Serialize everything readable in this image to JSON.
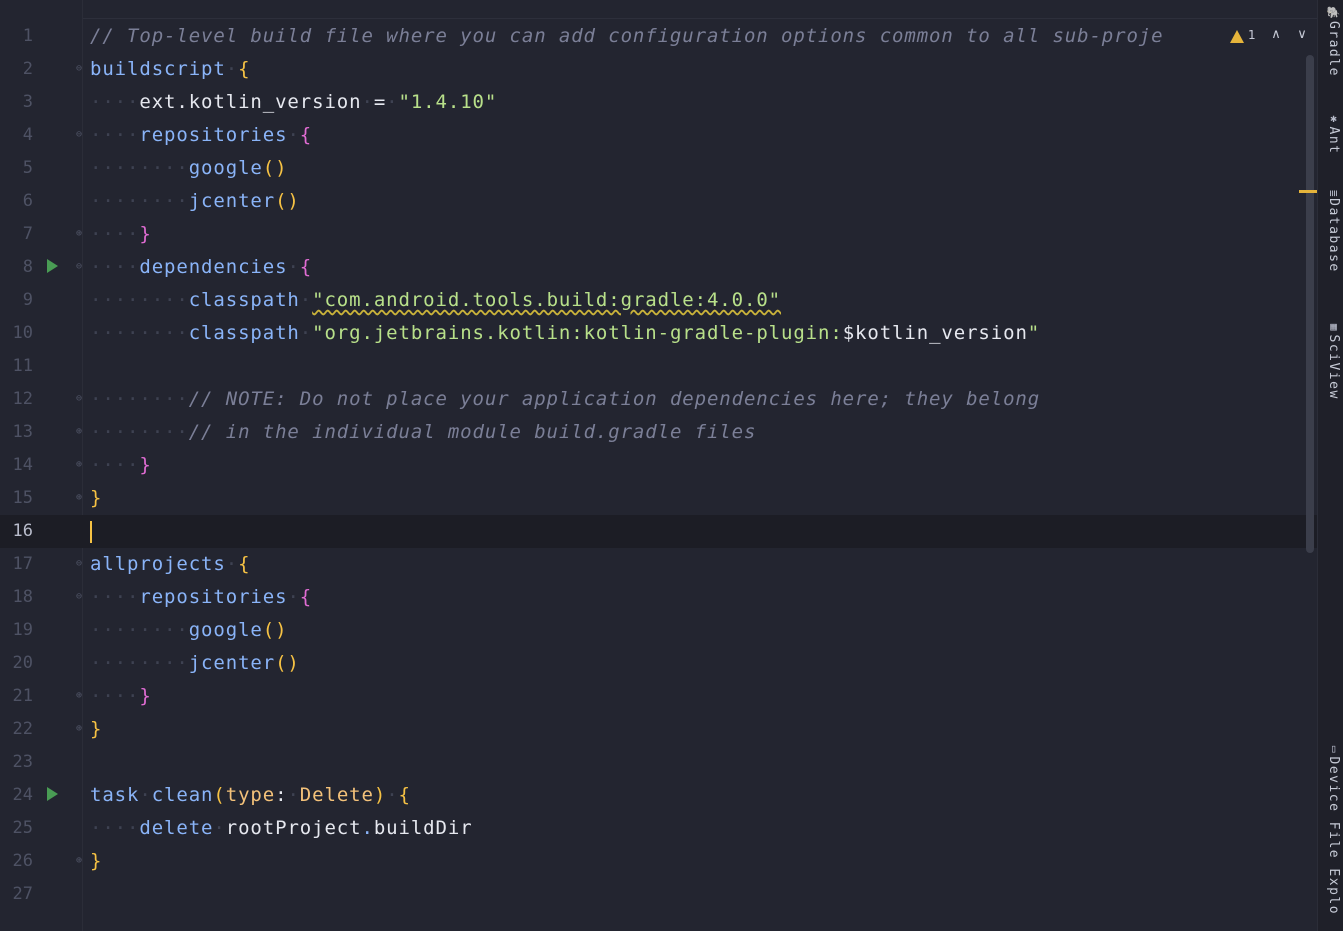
{
  "editor": {
    "current_line": 16,
    "warning_count": "1",
    "warning_up": "∧",
    "warning_down": "∨",
    "lines": [
      {
        "n": "1"
      },
      {
        "n": "2"
      },
      {
        "n": "3"
      },
      {
        "n": "4"
      },
      {
        "n": "5"
      },
      {
        "n": "6"
      },
      {
        "n": "7"
      },
      {
        "n": "8"
      },
      {
        "n": "9"
      },
      {
        "n": "10"
      },
      {
        "n": "11"
      },
      {
        "n": "12"
      },
      {
        "n": "13"
      },
      {
        "n": "14"
      },
      {
        "n": "15"
      },
      {
        "n": "16"
      },
      {
        "n": "17"
      },
      {
        "n": "18"
      },
      {
        "n": "19"
      },
      {
        "n": "20"
      },
      {
        "n": "21"
      },
      {
        "n": "22"
      },
      {
        "n": "23"
      },
      {
        "n": "24"
      },
      {
        "n": "25"
      },
      {
        "n": "26"
      },
      {
        "n": "27"
      }
    ],
    "code": {
      "l1_comment": "// Top-level build file where you can add configuration options common to all sub-proje",
      "l2_kw": "buildscript",
      "l3_id": "ext.kotlin_version",
      "l3_eq": "=",
      "l3_str": "\"1.4.10\"",
      "l4_kw": "repositories",
      "l5_kw": "google",
      "l6_kw": "jcenter",
      "l8_kw": "dependencies",
      "l9_kw": "classpath",
      "l9_str": "\"com.android.tools.build:gradle:4.0.0\"",
      "l10_kw": "classpath",
      "l10_str": "\"org.jetbrains.kotlin:kotlin-gradle-plugin:",
      "l10_var": "$kotlin_version",
      "l10_end": "\"",
      "l12_comment": "// NOTE: Do not place your application dependencies here; they belong",
      "l13_comment": "// in the individual module build.gradle files",
      "l17_kw": "allprojects",
      "l18_kw": "repositories",
      "l19_kw": "google",
      "l20_kw": "jcenter",
      "l24_task": "task",
      "l24_clean": "clean",
      "l24_type": "type",
      "l24_colon": ":",
      "l24_delete_type": "Delete",
      "l25_delete": "delete",
      "l25_root": "rootProject",
      "l25_dot": ".",
      "l25_build": "buildDir",
      "brace_open": "{",
      "brace_close": "}",
      "paren_open": "(",
      "paren_close": ")",
      "parens": "()"
    }
  },
  "side_panel": {
    "tabs": [
      "Gradle",
      "Ant",
      "Database",
      "SciView",
      "Device File Explo"
    ]
  },
  "colors": {
    "background": "#232530",
    "keyword": "#8ab4f8",
    "string": "#b8e08a",
    "comment": "#7b7f97",
    "brace_yellow": "#f6c244",
    "brace_pink": "#e06cd3",
    "warning": "#e5b43b",
    "run_icon": "#499c54"
  },
  "icons": [
    "play-icon",
    "fold-icon",
    "warning-icon",
    "chevron-up-icon",
    "chevron-down-icon",
    "gradle-icon",
    "ant-icon",
    "database-icon",
    "sciview-icon",
    "device-file-icon"
  ]
}
